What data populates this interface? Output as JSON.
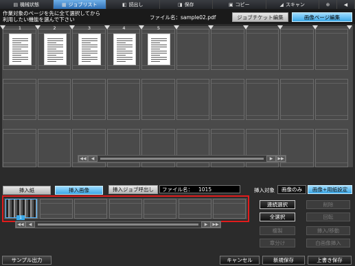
{
  "topbar": {
    "tabs": [
      {
        "label": "機械状態",
        "icon": "machine-status-icon",
        "glyph": "▤"
      },
      {
        "label": "ジョブリスト",
        "icon": "job-list-icon",
        "glyph": "▦",
        "active": true
      },
      {
        "label": "読出し",
        "icon": "recall-icon",
        "glyph": "◧"
      },
      {
        "label": "保存",
        "icon": "save-icon",
        "glyph": "◨"
      },
      {
        "label": "コピー",
        "icon": "copy-icon",
        "glyph": "▣"
      },
      {
        "label": "スキャン",
        "icon": "scan-icon",
        "glyph": "◢"
      },
      {
        "label": "",
        "icon": "globe-icon",
        "glyph": "⊕"
      },
      {
        "label": "",
        "icon": "speaker-icon",
        "glyph": "◀"
      }
    ]
  },
  "header": {
    "instruction": "作業対象のページを先に全て選択してから\n利用したい機能を選んで下さい",
    "file_name": "ファイル名：sample02.pdf",
    "job_ticket_btn": "ジョブチケット編集",
    "image_page_btn": "画像ページ編集"
  },
  "pages": [
    "1",
    "2",
    "3",
    "4",
    "5"
  ],
  "insert": {
    "paper_btn": "挿入紙",
    "image_btn": "挿入画像",
    "recall_job_btn": "挿入ジョブ呼出し",
    "file_label": "ファイル名：",
    "file_name": "1015",
    "target_label": "挿入対象",
    "image_only": "画像のみ",
    "image_settings": "画像+用紙設定",
    "thumb_num": "1"
  },
  "side": {
    "continuous_select": "連続選択",
    "select_all": "全選択",
    "delete": "削除",
    "rotate": "回転",
    "duplicate": "複製",
    "insert_move": "挿入/移動",
    "split": "章分け",
    "blank_insert": "白画像挿入"
  },
  "footer": {
    "sample_output": "サンプル出力",
    "cancel": "キャンセル",
    "new_save": "新規保存",
    "overwrite_save": "上書き保存"
  }
}
